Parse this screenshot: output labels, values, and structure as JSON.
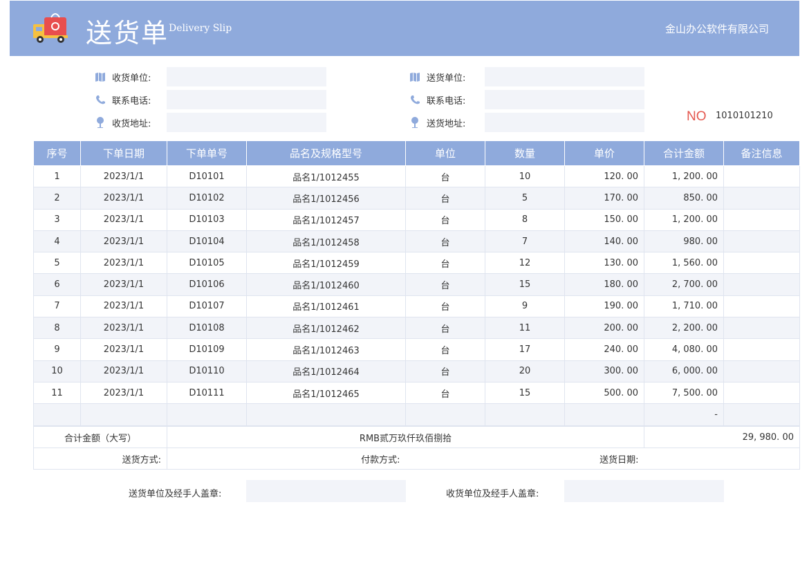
{
  "header": {
    "title": "送货单",
    "subtitle": "Delivery Slip",
    "company": "金山办公软件有限公司",
    "colors": {
      "banner": "#8faadc",
      "accent_no": "#e4574e"
    }
  },
  "receiver": {
    "unit_label": "收货单位:",
    "phone_label": "联系电话:",
    "address_label": "收货地址:",
    "unit_value": "",
    "phone_value": "",
    "address_value": ""
  },
  "sender": {
    "unit_label": "送货单位:",
    "phone_label": "联系电话:",
    "address_label": "送货地址:",
    "unit_value": "",
    "phone_value": "",
    "address_value": ""
  },
  "doc_no": {
    "label": "NO",
    "value": "1010101210"
  },
  "table": {
    "headers": [
      "序号",
      "下单日期",
      "下单单号",
      "品名及规格型号",
      "单位",
      "数量",
      "单价",
      "合计金额",
      "备注信息"
    ],
    "rows": [
      [
        "1",
        "2023/1/1",
        "D10101",
        "品名1/1012455",
        "台",
        "10",
        "120. 00",
        "1, 200. 00",
        ""
      ],
      [
        "2",
        "2023/1/1",
        "D10102",
        "品名1/1012456",
        "台",
        "5",
        "170. 00",
        "850. 00",
        ""
      ],
      [
        "3",
        "2023/1/1",
        "D10103",
        "品名1/1012457",
        "台",
        "8",
        "150. 00",
        "1, 200. 00",
        ""
      ],
      [
        "4",
        "2023/1/1",
        "D10104",
        "品名1/1012458",
        "台",
        "7",
        "140. 00",
        "980. 00",
        ""
      ],
      [
        "5",
        "2023/1/1",
        "D10105",
        "品名1/1012459",
        "台",
        "12",
        "130. 00",
        "1, 560. 00",
        ""
      ],
      [
        "6",
        "2023/1/1",
        "D10106",
        "品名1/1012460",
        "台",
        "15",
        "180. 00",
        "2, 700. 00",
        ""
      ],
      [
        "7",
        "2023/1/1",
        "D10107",
        "品名1/1012461",
        "台",
        "9",
        "190. 00",
        "1, 710. 00",
        ""
      ],
      [
        "8",
        "2023/1/1",
        "D10108",
        "品名1/1012462",
        "台",
        "11",
        "200. 00",
        "2, 200. 00",
        ""
      ],
      [
        "9",
        "2023/1/1",
        "D10109",
        "品名1/1012463",
        "台",
        "17",
        "240. 00",
        "4, 080. 00",
        ""
      ],
      [
        "10",
        "2023/1/1",
        "D10110",
        "品名1/1012464",
        "台",
        "20",
        "300. 00",
        "6, 000. 00",
        ""
      ],
      [
        "11",
        "2023/1/1",
        "D10111",
        "品名1/1012465",
        "台",
        "15",
        "500. 00",
        "7, 500. 00",
        ""
      ],
      [
        "",
        "",
        "",
        "",
        "",
        "",
        "",
        "-",
        ""
      ]
    ]
  },
  "totals": {
    "label": "合计金额（大写）",
    "in_words": "RMB贰万玖仟玖佰捌拾",
    "amount": "29, 980. 00",
    "delivery_method_label": "送货方式:",
    "payment_method_label": "付款方式:",
    "delivery_date_label": "送货日期:"
  },
  "seals": {
    "sender_label": "送货单位及经手人盖章:",
    "receiver_label": "收货单位及经手人盖章:"
  }
}
